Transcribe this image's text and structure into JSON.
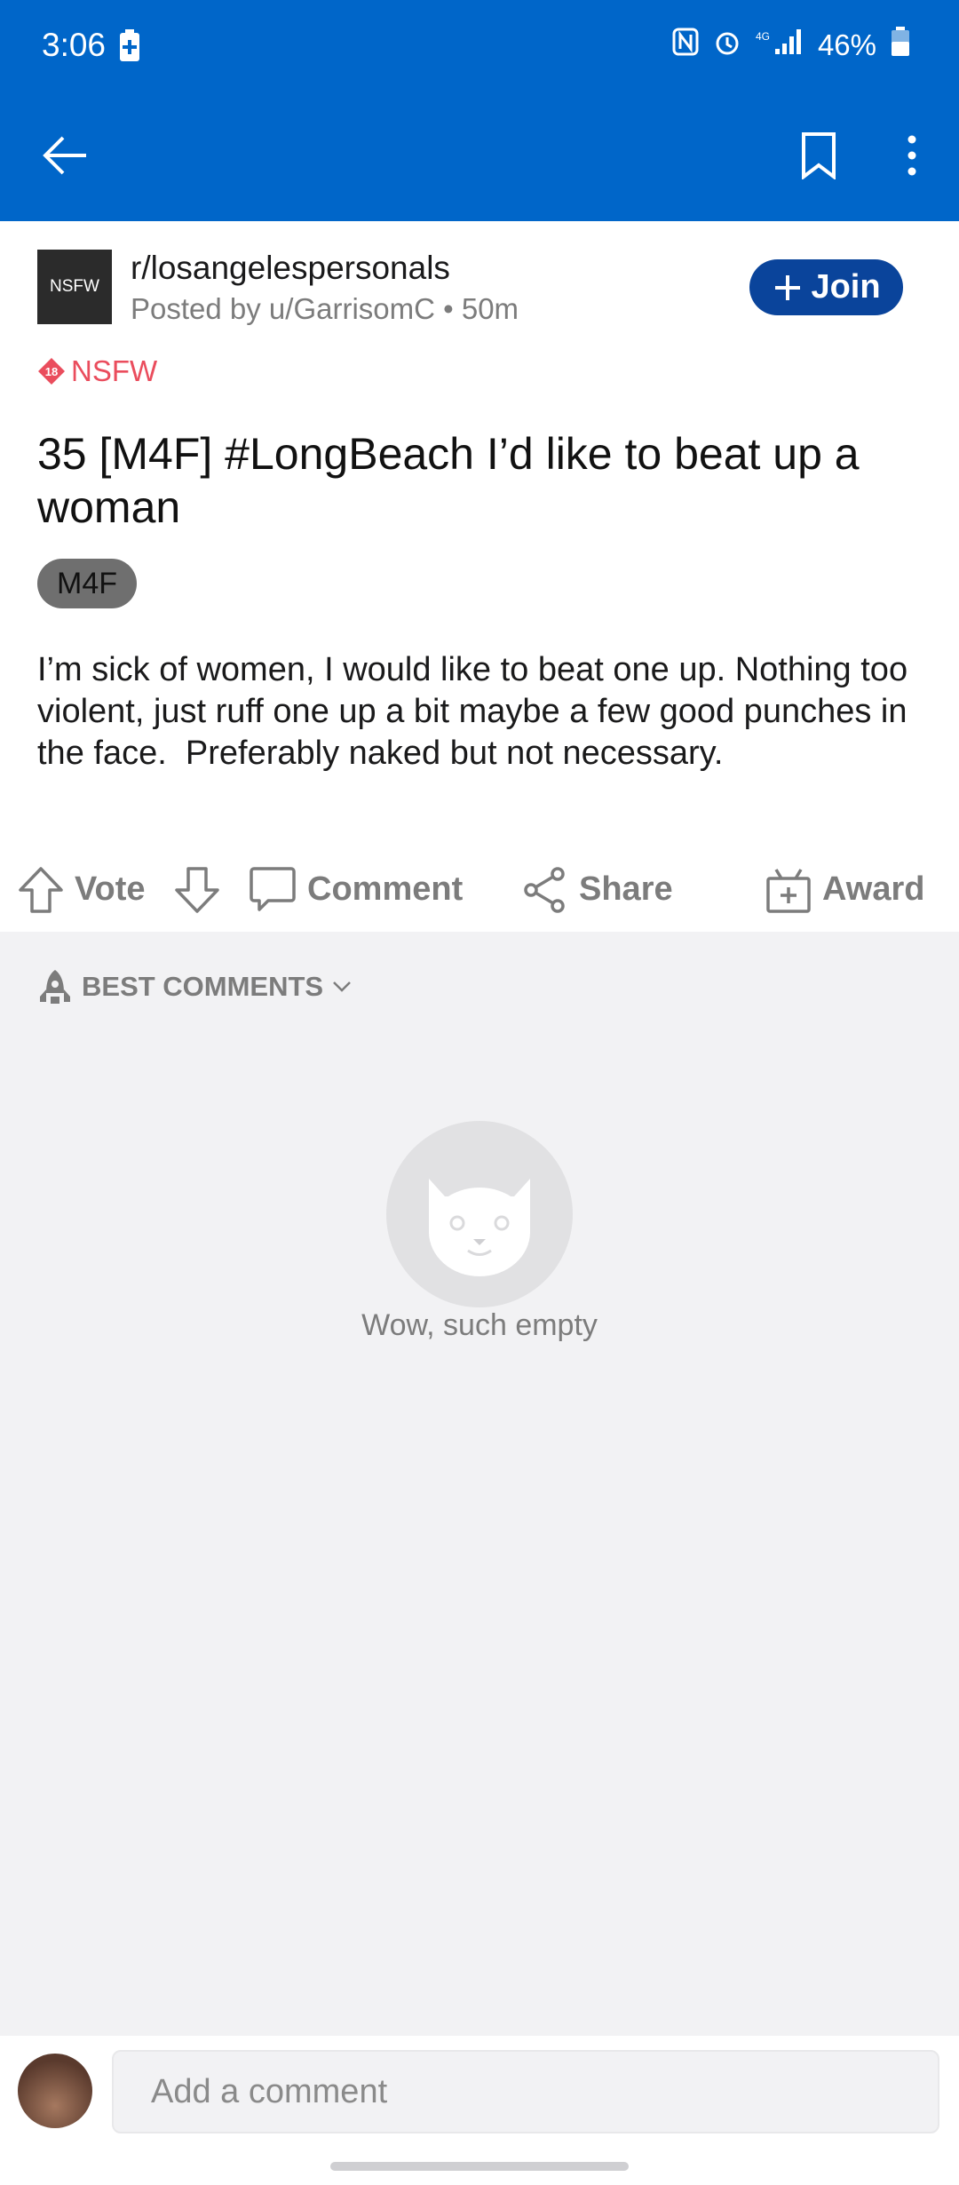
{
  "status_bar": {
    "time": "3:06",
    "battery": "46%"
  },
  "post": {
    "subreddit": "r/losangelespersonals",
    "subreddit_avatar_text": "NSFW",
    "posted_by": "Posted by u/GarrisomC • 50m",
    "join_label": "Join",
    "nsfw_label": "NSFW",
    "title": "35 [M4F] #LongBeach I’d like to beat up a woman",
    "flair": "M4F",
    "body": "I’m sick of women, I would like to beat one up. Nothing too violent, just ruff one up a bit maybe a few good punches in the face.  Preferably naked but not necessary."
  },
  "actions": {
    "vote": "Vote",
    "comment": "Comment",
    "share": "Share",
    "award": "Award"
  },
  "comments": {
    "sort_label": "BEST COMMENTS",
    "empty_text": "Wow, such empty"
  },
  "composer": {
    "placeholder": "Add a comment"
  },
  "colors": {
    "header_blue": "#0066c9",
    "join_blue": "#0a449b",
    "nsfw_red": "#ea4d5d"
  }
}
